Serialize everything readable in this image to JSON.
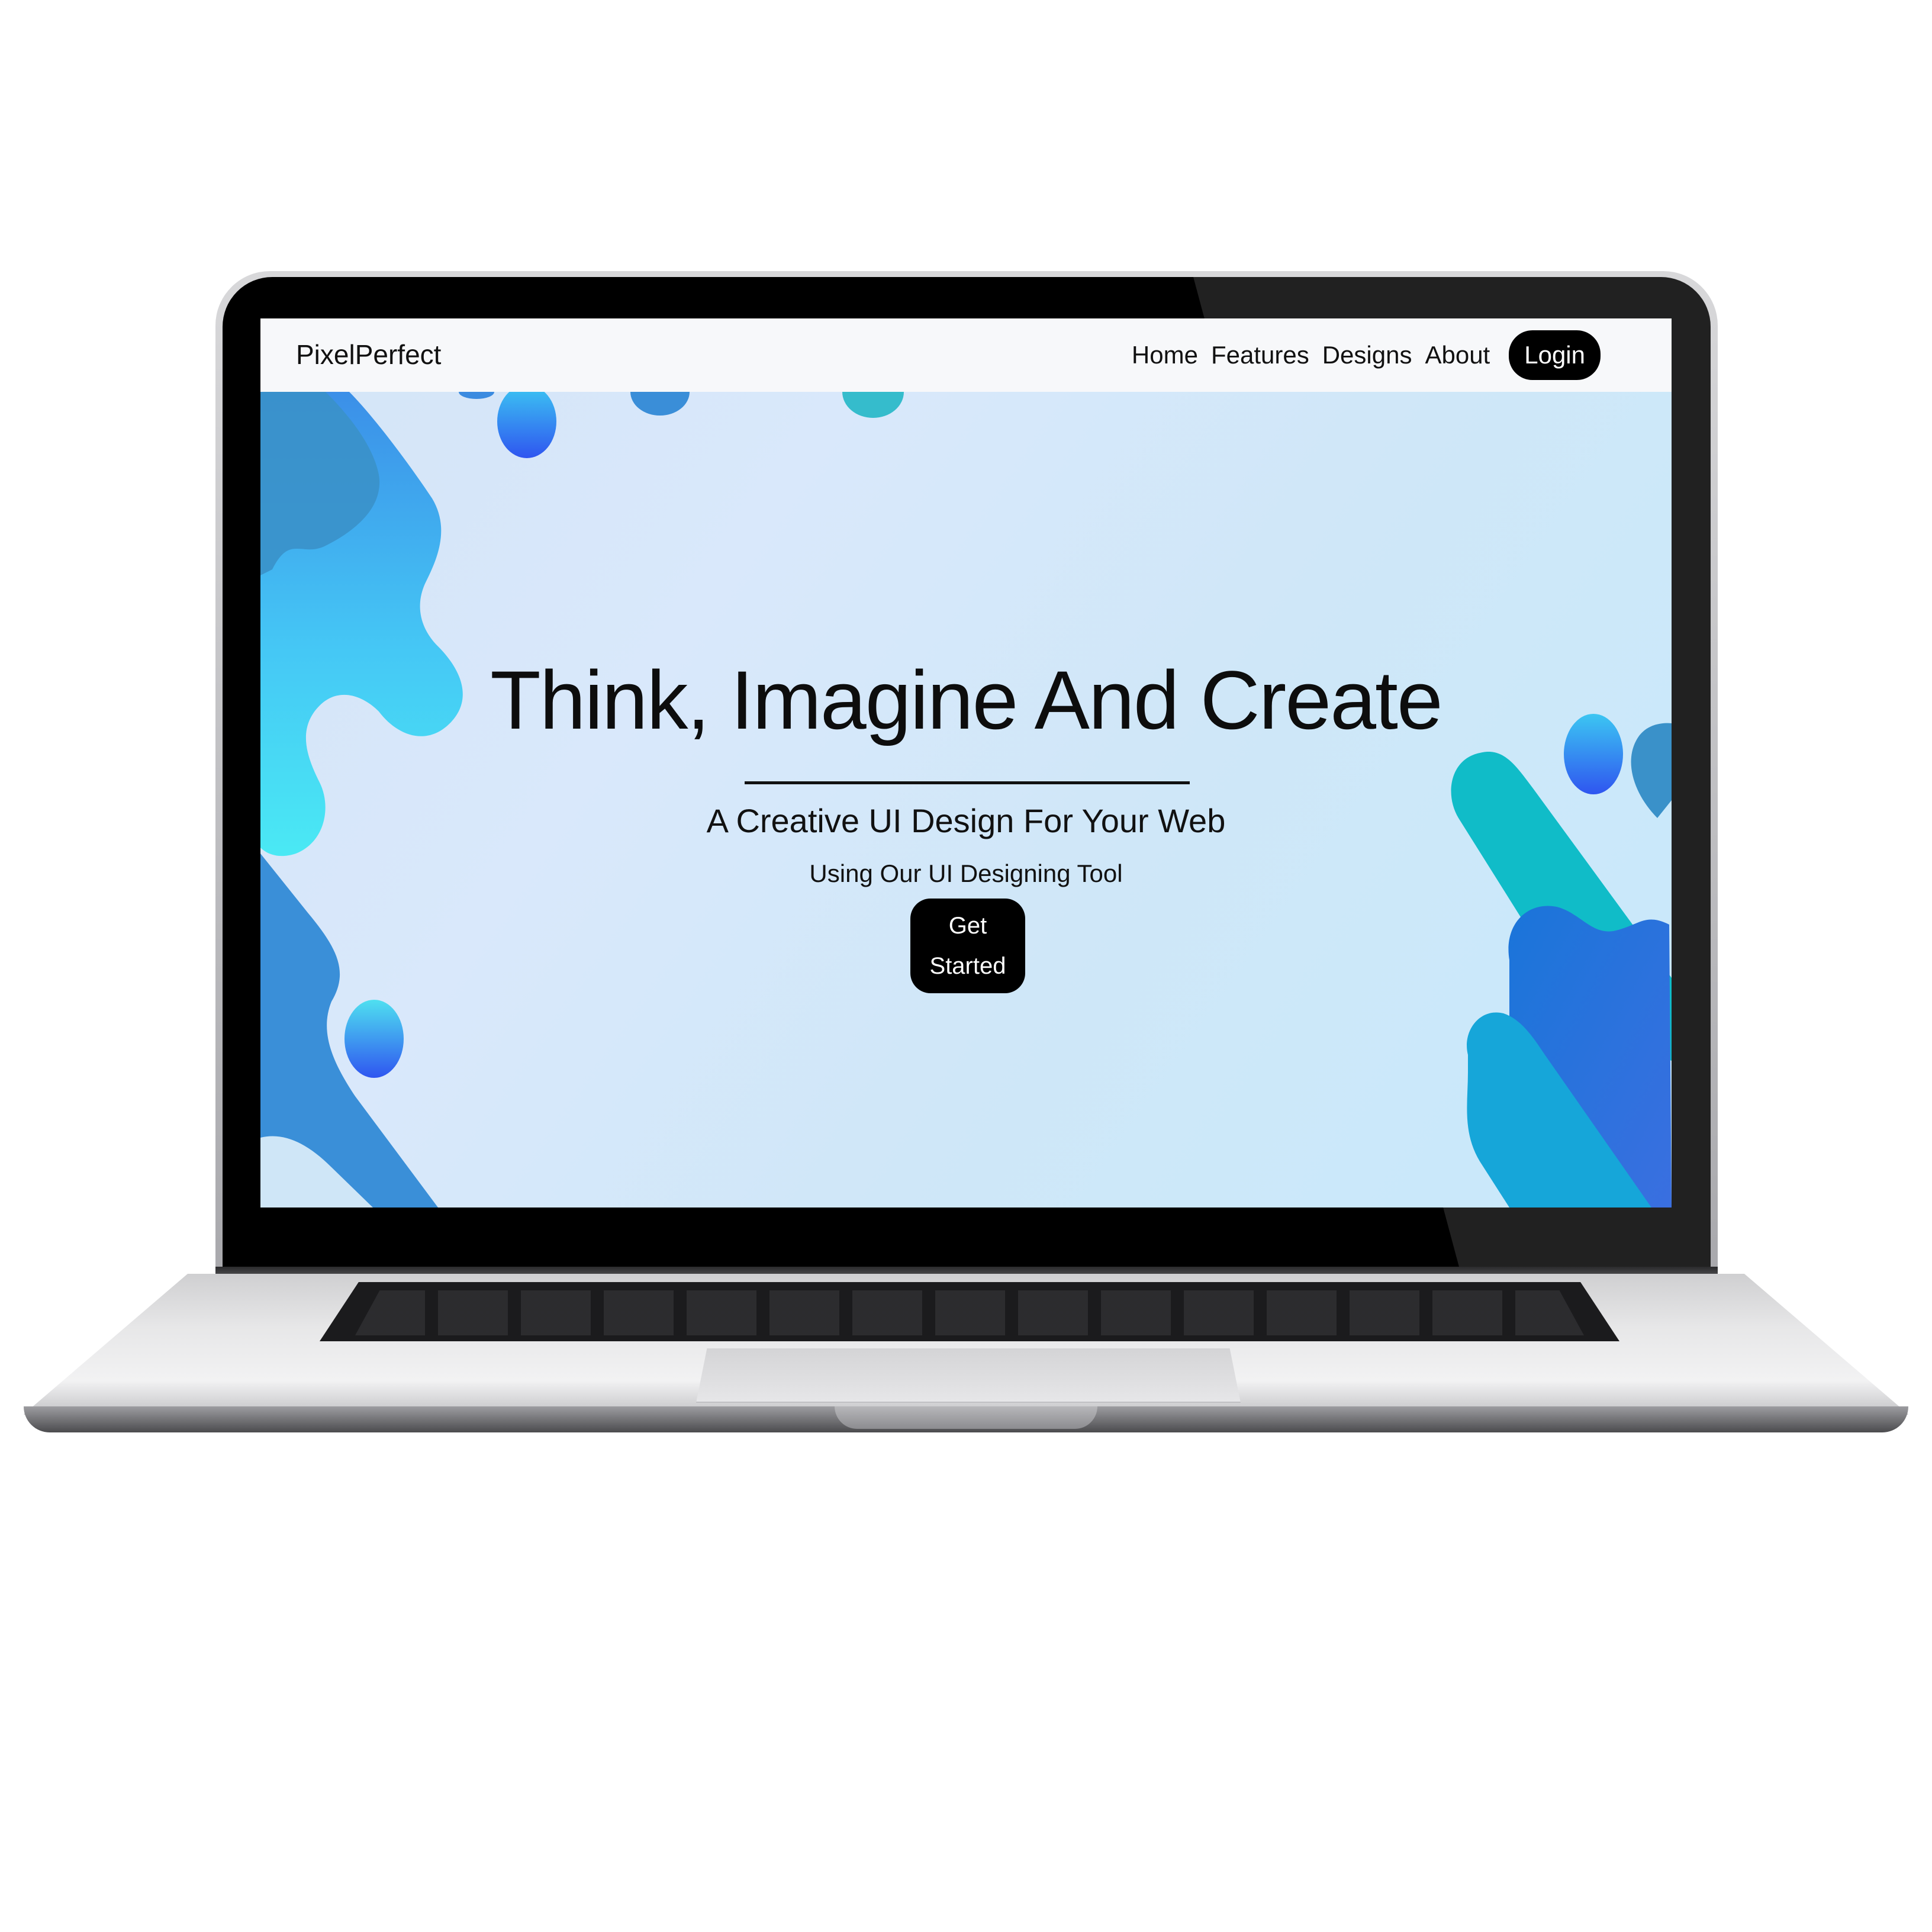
{
  "brand": "PixelPerfect",
  "nav": {
    "items": [
      "Home",
      "Features",
      "Designs",
      "About"
    ],
    "login_label": "Login"
  },
  "hero": {
    "headline": "Think, Imagine And Create",
    "subheadline": "A Creative UI Design For Your Web",
    "tagline": "Using Our UI Designing Tool",
    "cta_label": "Get Started"
  },
  "colors": {
    "button_bg": "#000000",
    "accent_blue": "#3a8ee6",
    "accent_cyan": "#3fd9ee",
    "accent_teal": "#14b9c6",
    "hero_bg": "#d6e8f8"
  }
}
